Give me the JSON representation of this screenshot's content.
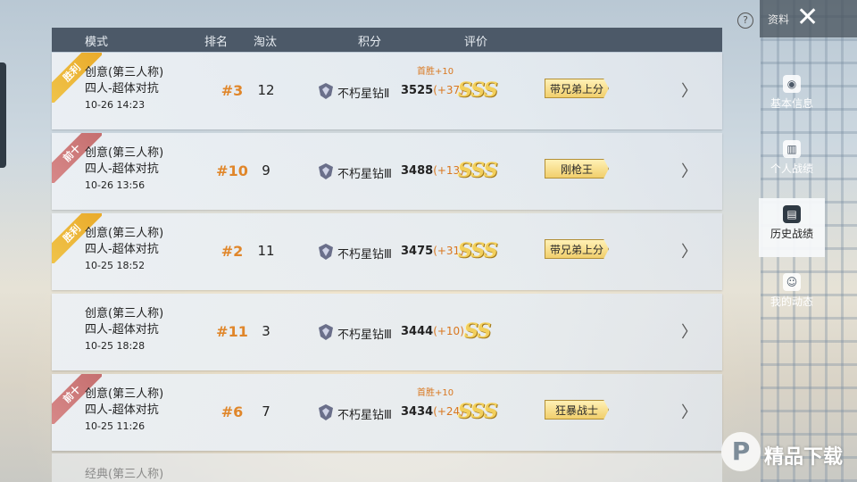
{
  "header": {
    "mode": "模式",
    "rank": "排名",
    "kills": "淘汰",
    "points": "积分",
    "rating": "评价"
  },
  "rows": [
    {
      "ribbon": "胜利",
      "mode": "创意(第三人称)",
      "type": "四人-超体对抗",
      "time": "10-26 14:23",
      "rank": "#3",
      "kills": "12",
      "tier": "不朽星钻Ⅱ",
      "score": "3525",
      "delta": "(+37)",
      "bonus": "首胜+10",
      "grade": "SSS",
      "title": "带兄弟上分"
    },
    {
      "ribbon": "前十",
      "mode": "创意(第三人称)",
      "type": "四人-超体对抗",
      "time": "10-26 13:56",
      "rank": "#10",
      "kills": "9",
      "tier": "不朽星钻Ⅲ",
      "score": "3488",
      "delta": "(+13)",
      "bonus": "",
      "grade": "SSS",
      "title": "刚枪王"
    },
    {
      "ribbon": "胜利",
      "mode": "创意(第三人称)",
      "type": "四人-超体对抗",
      "time": "10-25 18:52",
      "rank": "#2",
      "kills": "11",
      "tier": "不朽星钻Ⅲ",
      "score": "3475",
      "delta": "(+31)",
      "bonus": "",
      "grade": "SSS",
      "title": "带兄弟上分"
    },
    {
      "ribbon": "",
      "mode": "创意(第三人称)",
      "type": "四人-超体对抗",
      "time": "10-25 18:28",
      "rank": "#11",
      "kills": "3",
      "tier": "不朽星钻Ⅲ",
      "score": "3444",
      "delta": "(+10)",
      "bonus": "",
      "grade": "SS",
      "title": ""
    },
    {
      "ribbon": "前十",
      "mode": "创意(第三人称)",
      "type": "四人-超体对抗",
      "time": "10-25 11:26",
      "rank": "#6",
      "kills": "7",
      "tier": "不朽星钻Ⅲ",
      "score": "3434",
      "delta": "(+24)",
      "bonus": "首胜+10",
      "grade": "SSS",
      "title": "狂暴战士"
    }
  ],
  "peek_row": "经典(第三人称)",
  "top_right": {
    "label": "资料",
    "help": "?"
  },
  "sidebar": [
    {
      "label": "基本信息",
      "icon": "profile-icon"
    },
    {
      "label": "个人战绩",
      "icon": "stats-icon"
    },
    {
      "label": "历史战绩",
      "icon": "history-icon",
      "active": true
    },
    {
      "label": "我的动态",
      "icon": "moments-icon"
    }
  ],
  "watermark": {
    "logo": "P",
    "text": "精品下载"
  },
  "colors": {
    "accent": "#e0862a",
    "header_bg": "#4c5968",
    "gold": "#f2cf5c"
  }
}
